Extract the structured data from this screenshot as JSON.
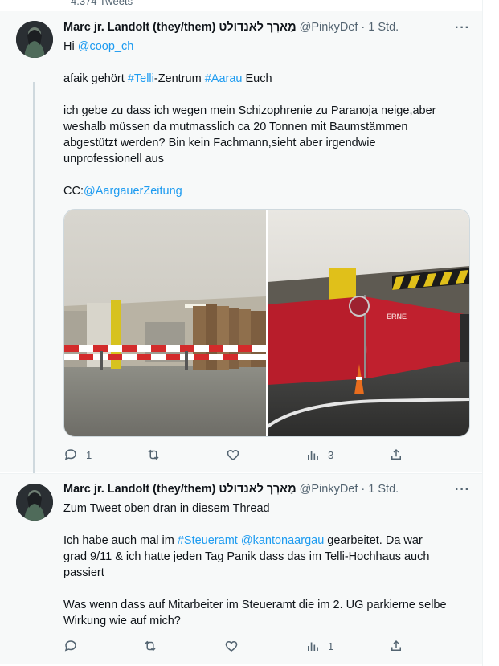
{
  "top": {
    "count_text": "4.374 Tweets"
  },
  "tweet1": {
    "author_name": "Marc jr. Landolt (they/them) מַארְך לאנדולט",
    "handle": "@PinkyDef",
    "separator": "·",
    "time": "1 Std.",
    "more": "···",
    "line1": {
      "prefix": "Hi ",
      "mention": "@coop_ch"
    },
    "line2": {
      "pre": "afaik gehört ",
      "tag1": "#Telli",
      "mid": "-Zentrum ",
      "tag2": "#Aarau",
      "post": " Euch"
    },
    "line3": "ich gebe zu dass ich wegen mein Schizophrenie zu Paranoja neige,aber",
    "line4": "weshalb müssen da mutmasslich ca 20 Tonnen mit Baumstämmen",
    "line5": "abgestützt werden? Bin kein Fachmann,sieht aber irgendwie",
    "line6": "unprofessionell aus",
    "line7": {
      "prefix": "CC:",
      "mention": "@AargauerZeitung"
    },
    "actions": {
      "replies": "1",
      "views": "3"
    }
  },
  "tweet2": {
    "author_name": "Marc jr. Landolt (they/them) מַארְך לאנדולט",
    "handle": "@PinkyDef",
    "separator": "·",
    "time": "1 Std.",
    "more": "···",
    "line1": "Zum Tweet oben dran in diesem Thread",
    "line2": {
      "pre": "Ich habe auch mal im ",
      "tag": "#Steueramt",
      "space": " ",
      "mention": "@kantonaargau",
      "post": " gearbeitet. Da war"
    },
    "line3": "grad 9/11 & ich hatte jeden Tag Panik dass das im Telli-Hochhaus auch",
    "line4": "passiert",
    "line5": "Was wenn dass auf Mitarbeiter im Steueramt die im 2. UG parkierne selbe",
    "line6": "Wirkung wie auf mich?",
    "actions": {
      "views": "1"
    }
  },
  "colors": {
    "link": "#1d9bf0",
    "text": "#0f1419",
    "muted": "#536471",
    "barrier_red": "#d32b2b",
    "fence_red": "#c0202e"
  },
  "icons": [
    "reply-icon",
    "retweet-icon",
    "like-icon",
    "views-icon",
    "share-icon",
    "more-icon"
  ]
}
